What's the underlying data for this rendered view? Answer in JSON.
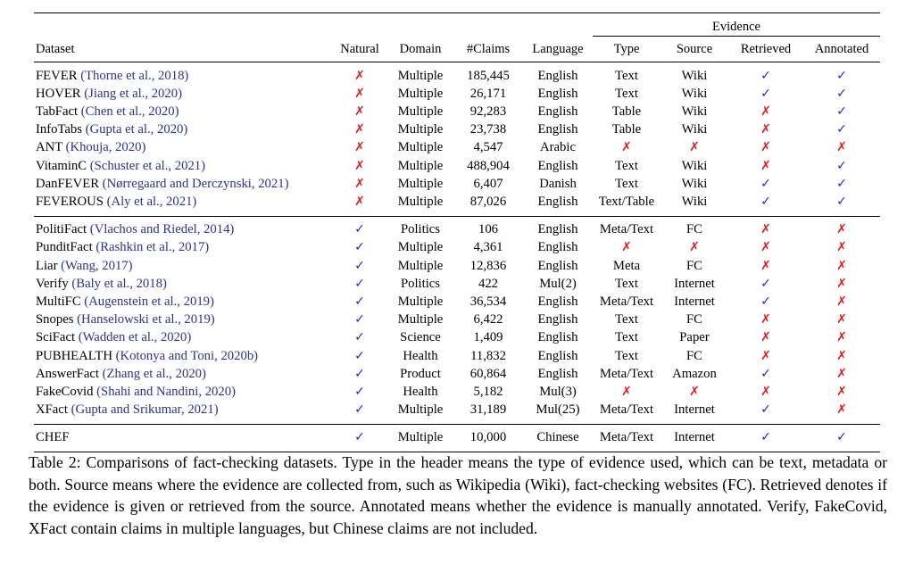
{
  "table": {
    "label": "Table 2",
    "headers": {
      "dataset": "Dataset",
      "natural": "Natural",
      "domain": "Domain",
      "claims": "#Claims",
      "language": "Language",
      "evidence_group": "Evidence",
      "type": "Type",
      "source": "Source",
      "retrieved": "Retrieved",
      "annotated": "Annotated"
    },
    "marks": {
      "yes": "✓",
      "no": "✗"
    },
    "colors": {
      "yes": "#2323d8",
      "no": "#e01b1b",
      "citation": "#2e3092",
      "rule": "#000000"
    },
    "groups": [
      {
        "rows": [
          {
            "name": "FEVER",
            "citation": "(Thorne et al., 2018)",
            "natural": "✗",
            "domain": "Multiple",
            "claims": "185,445",
            "language": "English",
            "type": "Text",
            "source": "Wiki",
            "retrieved": "✓",
            "annotated": "✓"
          },
          {
            "name": "HOVER",
            "citation": "(Jiang et al., 2020)",
            "natural": "✗",
            "domain": "Multiple",
            "claims": "26,171",
            "language": "English",
            "type": "Text",
            "source": "Wiki",
            "retrieved": "✓",
            "annotated": "✓"
          },
          {
            "name": "TabFact",
            "citation": "(Chen et al., 2020)",
            "natural": "✗",
            "domain": "Multiple",
            "claims": "92,283",
            "language": "English",
            "type": "Table",
            "source": "Wiki",
            "retrieved": "✗",
            "annotated": "✓"
          },
          {
            "name": "InfoTabs",
            "citation": "(Gupta et al., 2020)",
            "natural": "✗",
            "domain": "Multiple",
            "claims": "23,738",
            "language": "English",
            "type": "Table",
            "source": "Wiki",
            "retrieved": "✗",
            "annotated": "✓"
          },
          {
            "name": "ANT",
            "citation": "(Khouja, 2020)",
            "natural": "✗",
            "domain": "Multiple",
            "claims": "4,547",
            "language": "Arabic",
            "type": "✗",
            "source": "✗",
            "retrieved": "✗",
            "annotated": "✗"
          },
          {
            "name": "VitaminC",
            "citation": "(Schuster et al., 2021)",
            "natural": "✗",
            "domain": "Multiple",
            "claims": "488,904",
            "language": "English",
            "type": "Text",
            "source": "Wiki",
            "retrieved": "✗",
            "annotated": "✓"
          },
          {
            "name": "DanFEVER",
            "citation": "(Nørregaard and Derczynski, 2021)",
            "natural": "✗",
            "domain": "Multiple",
            "claims": "6,407",
            "language": "Danish",
            "type": "Text",
            "source": "Wiki",
            "retrieved": "✓",
            "annotated": "✓"
          },
          {
            "name": "FEVEROUS",
            "citation": "(Aly et al., 2021)",
            "natural": "✗",
            "domain": "Multiple",
            "claims": "87,026",
            "language": "English",
            "type": "Text/Table",
            "source": "Wiki",
            "retrieved": "✓",
            "annotated": "✓"
          }
        ]
      },
      {
        "rows": [
          {
            "name": "PolitiFact",
            "citation": "(Vlachos and Riedel, 2014)",
            "natural": "✓",
            "domain": "Politics",
            "claims": "106",
            "language": "English",
            "type": "Meta/Text",
            "source": "FC",
            "retrieved": "✗",
            "annotated": "✗"
          },
          {
            "name": "PunditFact",
            "citation": "(Rashkin et al., 2017)",
            "natural": "✓",
            "domain": "Multiple",
            "claims": "4,361",
            "language": "English",
            "type": "✗",
            "source": "✗",
            "retrieved": "✗",
            "annotated": "✗"
          },
          {
            "name": "Liar",
            "citation": "(Wang, 2017)",
            "natural": "✓",
            "domain": "Multiple",
            "claims": "12,836",
            "language": "English",
            "type": "Meta",
            "source": "FC",
            "retrieved": "✗",
            "annotated": "✗"
          },
          {
            "name": "Verify",
            "citation": "(Baly et al., 2018)",
            "natural": "✓",
            "domain": "Politics",
            "claims": "422",
            "language": "Mul(2)",
            "type": "Text",
            "source": "Internet",
            "retrieved": "✓",
            "annotated": "✗"
          },
          {
            "name": "MultiFC",
            "citation": "(Augenstein et al., 2019)",
            "natural": "✓",
            "domain": "Multiple",
            "claims": "36,534",
            "language": "English",
            "type": "Meta/Text",
            "source": "Internet",
            "retrieved": "✓",
            "annotated": "✗"
          },
          {
            "name": "Snopes",
            "citation": "(Hanselowski et al., 2019)",
            "natural": "✓",
            "domain": "Multiple",
            "claims": "6,422",
            "language": "English",
            "type": "Text",
            "source": "FC",
            "retrieved": "✗",
            "annotated": "✗"
          },
          {
            "name": "SciFact",
            "citation": "(Wadden et al., 2020)",
            "natural": "✓",
            "domain": "Science",
            "claims": "1,409",
            "language": "English",
            "type": "Text",
            "source": "Paper",
            "retrieved": "✗",
            "annotated": "✗"
          },
          {
            "name": "PUBHEALTH",
            "citation": "(Kotonya and Toni, 2020b)",
            "natural": "✓",
            "domain": "Health",
            "claims": "11,832",
            "language": "English",
            "type": "Text",
            "source": "FC",
            "retrieved": "✗",
            "annotated": "✗"
          },
          {
            "name": "AnswerFact",
            "citation": "(Zhang et al., 2020)",
            "natural": "✓",
            "domain": "Product",
            "claims": "60,864",
            "language": "English",
            "type": "Meta/Text",
            "source": "Amazon",
            "retrieved": "✓",
            "annotated": "✗"
          },
          {
            "name": "FakeCovid",
            "citation": "(Shahi and Nandini, 2020)",
            "natural": "✓",
            "domain": "Health",
            "claims": "5,182",
            "language": "Mul(3)",
            "type": "✗",
            "source": "✗",
            "retrieved": "✗",
            "annotated": "✗"
          },
          {
            "name": "XFact",
            "citation": "(Gupta and Srikumar, 2021)",
            "natural": "✓",
            "domain": "Multiple",
            "claims": "31,189",
            "language": "Mul(25)",
            "type": "Meta/Text",
            "source": "Internet",
            "retrieved": "✓",
            "annotated": "✗"
          }
        ]
      },
      {
        "rows": [
          {
            "name": "CHEF",
            "citation": "",
            "natural": "✓",
            "domain": "Multiple",
            "claims": "10,000",
            "language": "Chinese",
            "type": "Meta/Text",
            "source": "Internet",
            "retrieved": "✓",
            "annotated": "✓"
          }
        ]
      }
    ]
  },
  "caption": {
    "full": "Table 2: Comparisons of fact-checking datasets. Type in the header means the type of evidence used, which can be text, metadata or both. Source means where the evidence are collected from, such as Wikipedia (Wiki), fact-checking websites (FC). Retrieved denotes if the evidence is given or retrieved from the source. Annotated means whether the evidence is manually annotated. Verify, FakeCovid, XFact contain claims in multiple languages, but Chinese claims are not included."
  }
}
